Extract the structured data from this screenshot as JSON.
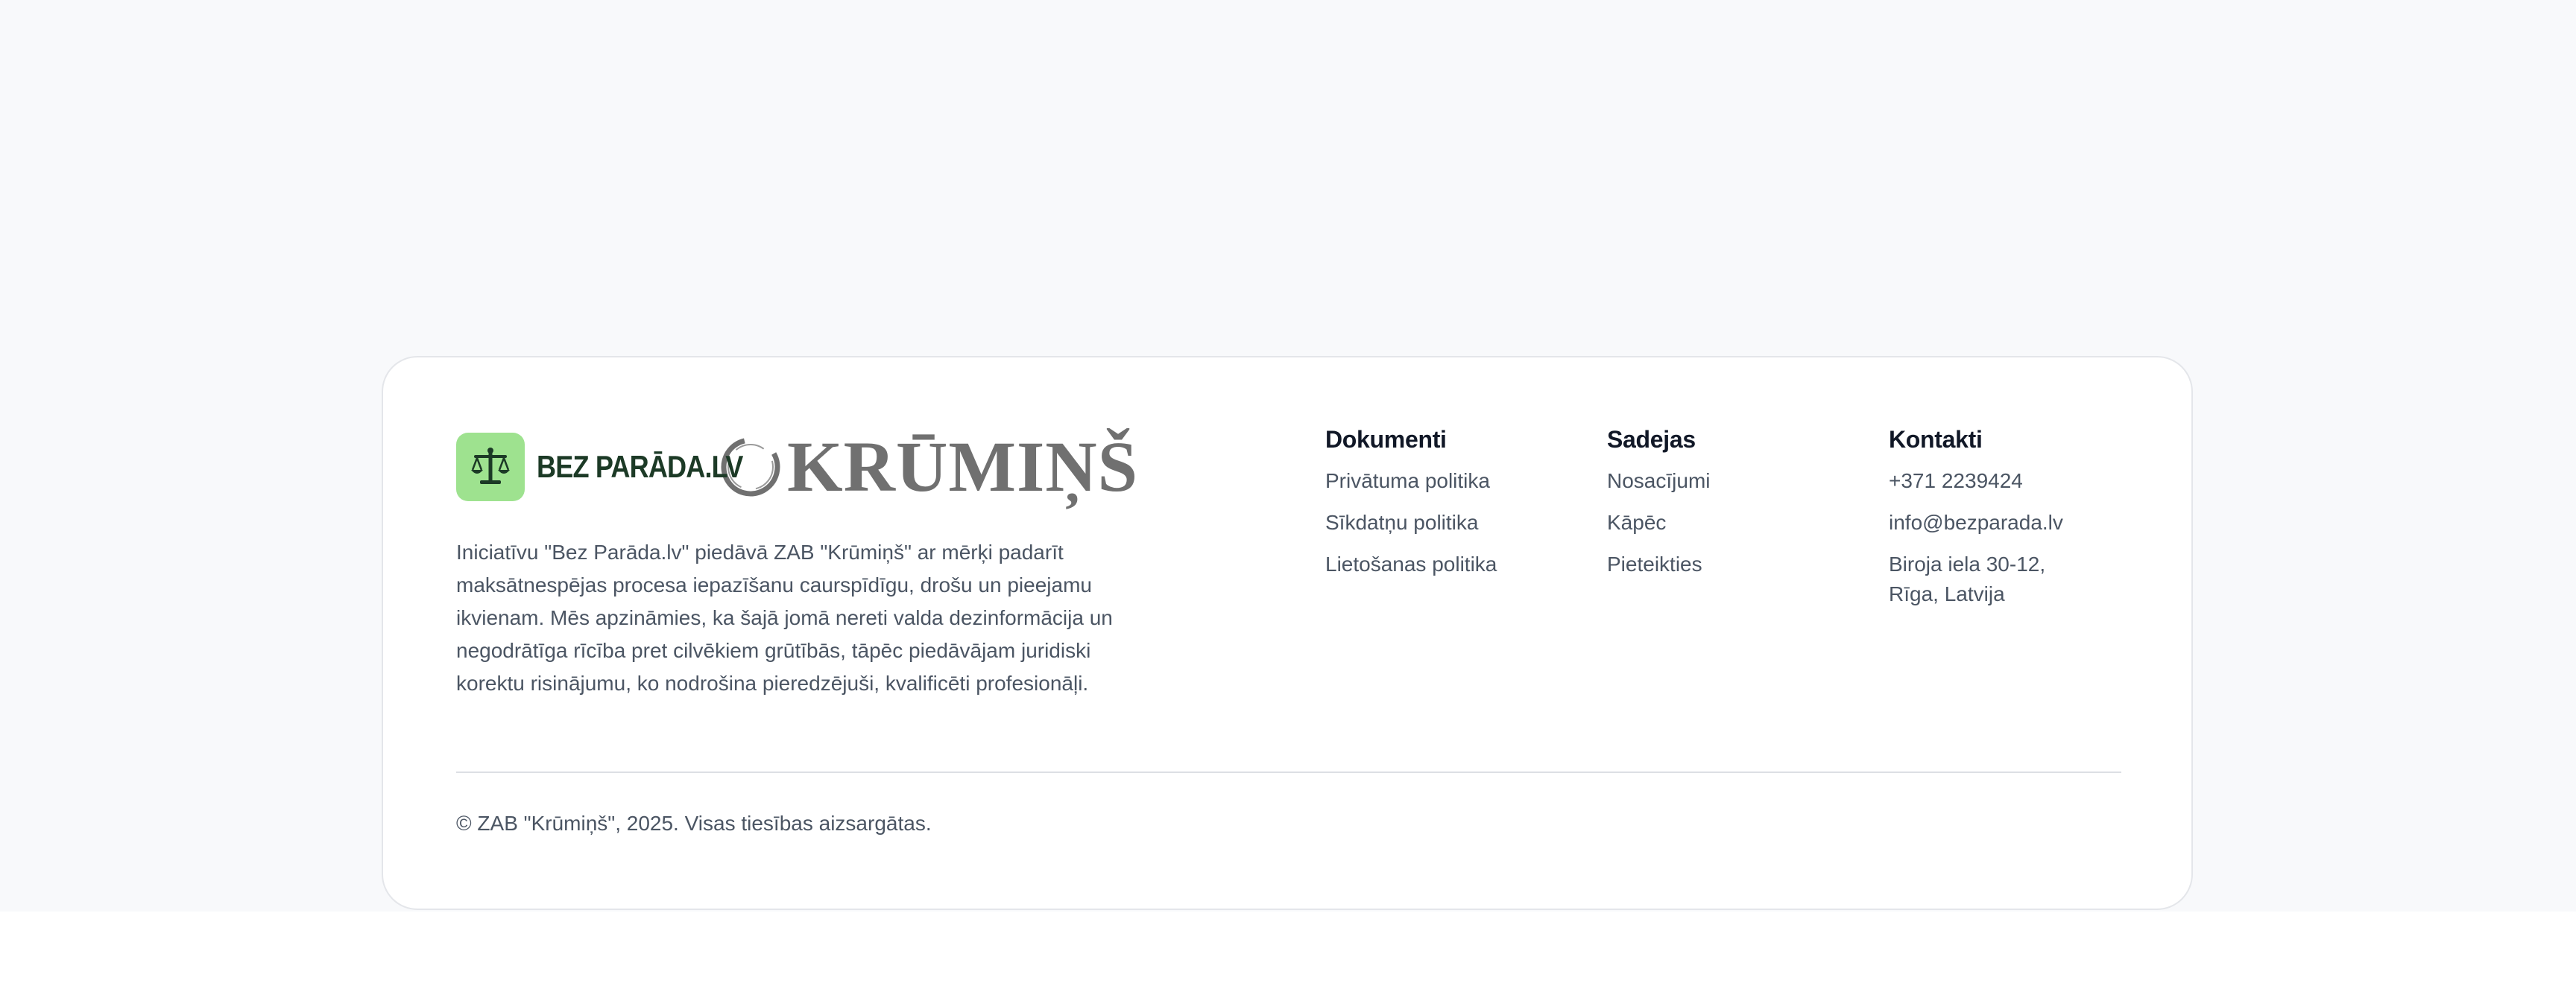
{
  "brand": {
    "bezparada_wordmark": "BEZ PARĀDA.LV",
    "bezparada_icon": "scales-icon",
    "bezparada_icon_bg": "#9ee28f",
    "bezparada_text_color": "#1c3a26",
    "krumins_wordmark": "KRŪMIŅŠ",
    "krumins_mark": "ring-mark-icon",
    "krumins_color": "#707070"
  },
  "description": "Iniciatīvu \"Bez Parāda.lv\" piedāvā ZAB \"Krūmiņš\" ar mērķi padarīt maksātnespējas procesa iepazīšanu caurspīdīgu, drošu un pieejamu ikvienam. Mēs apzināmies, ka šajā jomā nereti valda dezinformācija un negodrātīga rīcība pret cilvēkiem grūtībās, tāpēc piedāvājam juridiski korektu risinājumu, ko nodrošina pieredzējuši, kvalificēti profesionāļi.",
  "columns": {
    "documents": {
      "title": "Dokumenti",
      "links": [
        "Privātuma politika",
        "Sīkdatņu politika",
        "Lietošanas politika"
      ]
    },
    "cooperation": {
      "title": "Sadejas",
      "links": [
        "Nosacījumi",
        "Kāpēc",
        "Pieteikties"
      ]
    },
    "contacts": {
      "title": "Kontakti",
      "phone": "+371 2239424",
      "email": "info@bezparada.lv",
      "address_line1": "Biroja iela 30-12,",
      "address_line2": "Rīga, Latvija"
    }
  },
  "copyright": "© ZAB \"Krūmiņš\", 2025. Visas tiesības aizsargātas."
}
